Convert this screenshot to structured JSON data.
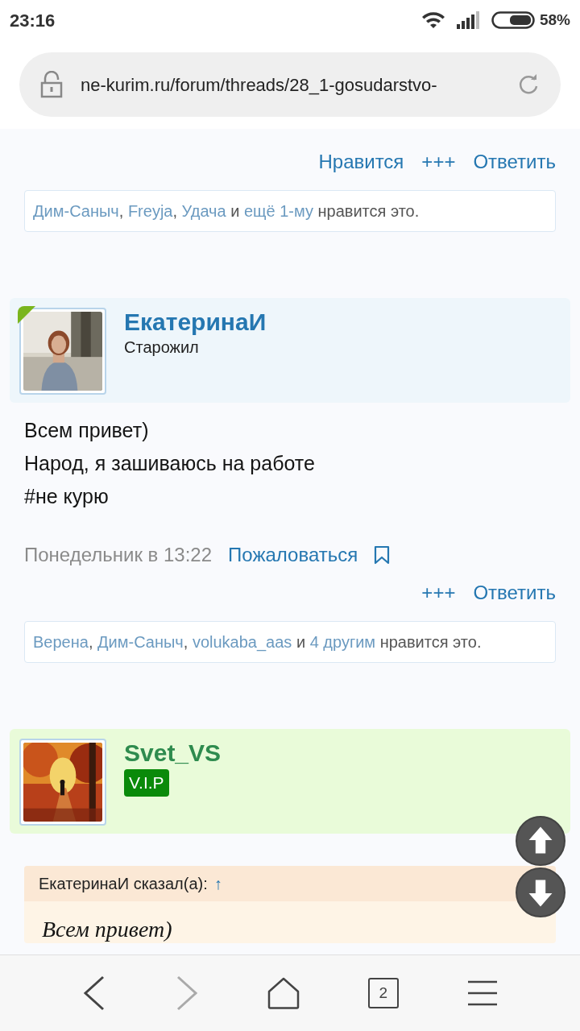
{
  "status_bar": {
    "time": "23:16",
    "battery": "58%"
  },
  "address_bar": {
    "url": "ne-kurim.ru/forum/threads/28_1-gosudarstvo-"
  },
  "top_actions": [
    "Нравится",
    "+++",
    "Ответить"
  ],
  "top_likes": [
    {
      "text": "Дим-Саныч",
      "link": true
    },
    {
      "text": ", ",
      "link": false
    },
    {
      "text": "Freyja",
      "link": true
    },
    {
      "text": ", ",
      "link": false
    },
    {
      "text": "Удача",
      "link": true
    },
    {
      "text": " и ",
      "link": false
    },
    {
      "text": "ещё 1-му",
      "link": true
    },
    {
      "text": " нравится это.",
      "link": false
    }
  ],
  "posts": [
    {
      "author": "ЕкатеринаИ",
      "title": "Старожил",
      "color": "#eef6fb",
      "online": true,
      "body": [
        "Всем привет)",
        "Народ, я зашиваюсь на работе",
        "#не курю"
      ],
      "date": "Понедельник в 13:22",
      "report": "Пожаловаться",
      "actions": [
        "+++",
        "Ответить"
      ],
      "likes": [
        {
          "text": "Верена",
          "link": true
        },
        {
          "text": ", ",
          "link": false
        },
        {
          "text": "Дим-Саныч",
          "link": true
        },
        {
          "text": ", ",
          "link": false
        },
        {
          "text": "volukaba_aas",
          "link": true
        },
        {
          "text": " и ",
          "link": false
        },
        {
          "text": "4 другим",
          "link": true
        },
        {
          "text": " нравится это.",
          "link": false
        }
      ]
    },
    {
      "author": "Svet_VS",
      "badge": "V.I.P",
      "color": "#e9fbd9",
      "online": false,
      "quote": {
        "source": "ЕкатеринаИ сказал(а):",
        "arrow": "↑",
        "lines": [
          "Всем привет)"
        ]
      }
    }
  ],
  "nav": {
    "tabs": "2"
  }
}
